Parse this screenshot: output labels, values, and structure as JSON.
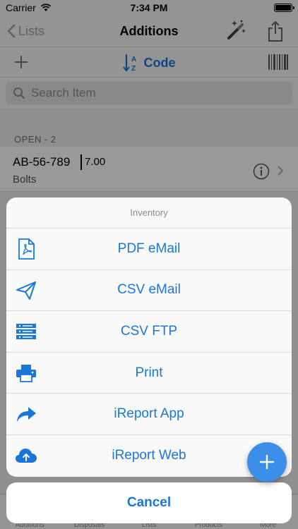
{
  "status_bar": {
    "carrier": "Carrier",
    "time": "7:34 PM"
  },
  "nav": {
    "back_label": "Lists",
    "title": "Additions"
  },
  "toolbar": {
    "sort_label": "Code",
    "sort_icon_letters": "AZ"
  },
  "search": {
    "placeholder": "Search Item",
    "value": ""
  },
  "list": {
    "section_header": "OPEN - 2",
    "rows": [
      {
        "code": "AB-56-789",
        "quantity": "7.00",
        "name": "Bolts"
      }
    ]
  },
  "tab_bar": {
    "items": [
      "Additions",
      "Disposals",
      "Lists",
      "Products",
      "More"
    ]
  },
  "action_sheet": {
    "title": "Inventory",
    "items": [
      {
        "label": "PDF eMail",
        "icon": "pdf-document-icon"
      },
      {
        "label": "CSV eMail",
        "icon": "paper-plane-icon"
      },
      {
        "label": "CSV FTP",
        "icon": "server-icon"
      },
      {
        "label": "Print",
        "icon": "printer-icon"
      },
      {
        "label": "iReport App",
        "icon": "share-arrow-icon"
      },
      {
        "label": "iReport Web",
        "icon": "cloud-upload-icon"
      }
    ],
    "cancel_label": "Cancel"
  },
  "colors": {
    "accent": "#1a77d8",
    "fab": "#3b8fe8"
  }
}
